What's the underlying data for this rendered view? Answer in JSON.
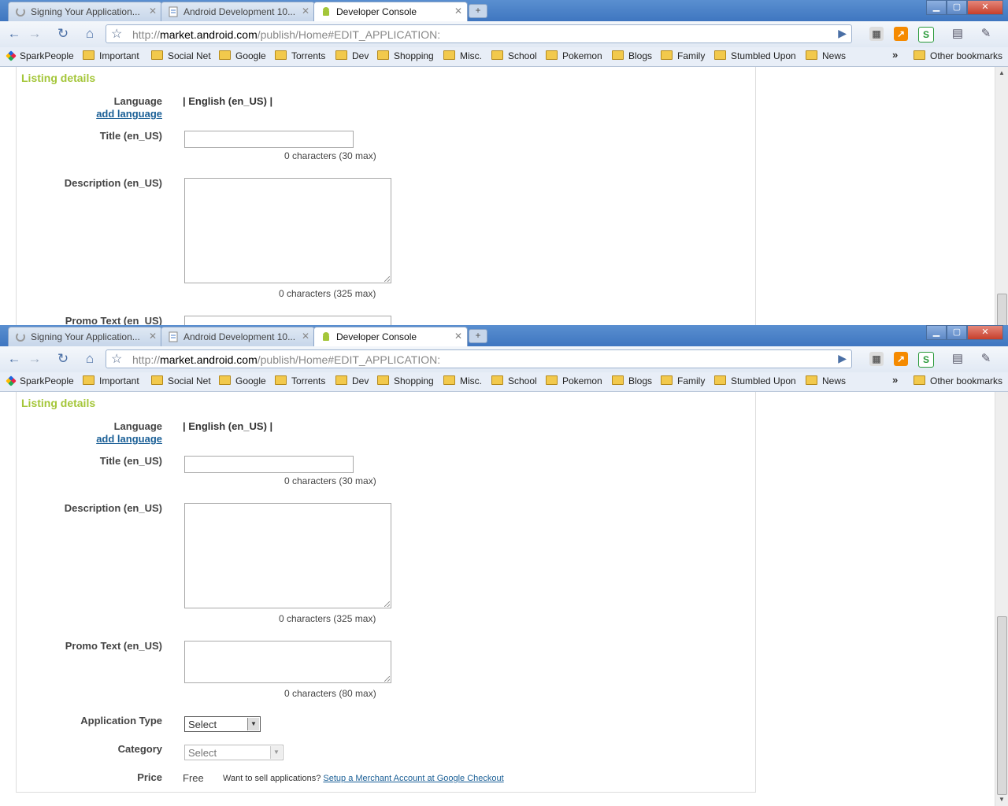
{
  "tabs": [
    {
      "title": "Signing Your Application...",
      "icon": "loading-icon"
    },
    {
      "title": "Android Development 10...",
      "icon": "page-icon"
    },
    {
      "title": "Developer Console",
      "icon": "android-icon",
      "active": true
    }
  ],
  "toolbar": {
    "url_prefix": "http://",
    "url_host": "market.android.com",
    "url_path": "/publish/Home#EDIT_APPLICATION:"
  },
  "bookmarks": [
    "SparkPeople",
    "Important",
    "Social Net",
    "Google",
    "Torrents",
    "Dev",
    "Shopping",
    "Misc.",
    "School",
    "Pokemon",
    "Blogs",
    "Family",
    "Stumbled Upon",
    "News"
  ],
  "other_bookmarks": "Other bookmarks",
  "form": {
    "section_title": "Listing details",
    "language_label": "Language",
    "add_language": "add language",
    "language_value": "| English (en_US) |",
    "title_label": "Title (en_US)",
    "title_count": "0 characters (30 max)",
    "description_label": "Description (en_US)",
    "description_count": "0 characters (325 max)",
    "promo_label": "Promo Text (en_US)",
    "promo_count": "0 characters (80 max)",
    "app_type_label": "Application Type",
    "app_type_value": "Select",
    "category_label": "Category",
    "category_value": "Select",
    "price_label": "Price",
    "price_value": "Free",
    "sell_text": "Want to sell applications?",
    "sell_link": "Setup a Merchant Account at Google Checkout"
  },
  "colors": {
    "accent": "#a4c639",
    "link": "#1a5f96",
    "titlebar": "#4a80c8"
  }
}
